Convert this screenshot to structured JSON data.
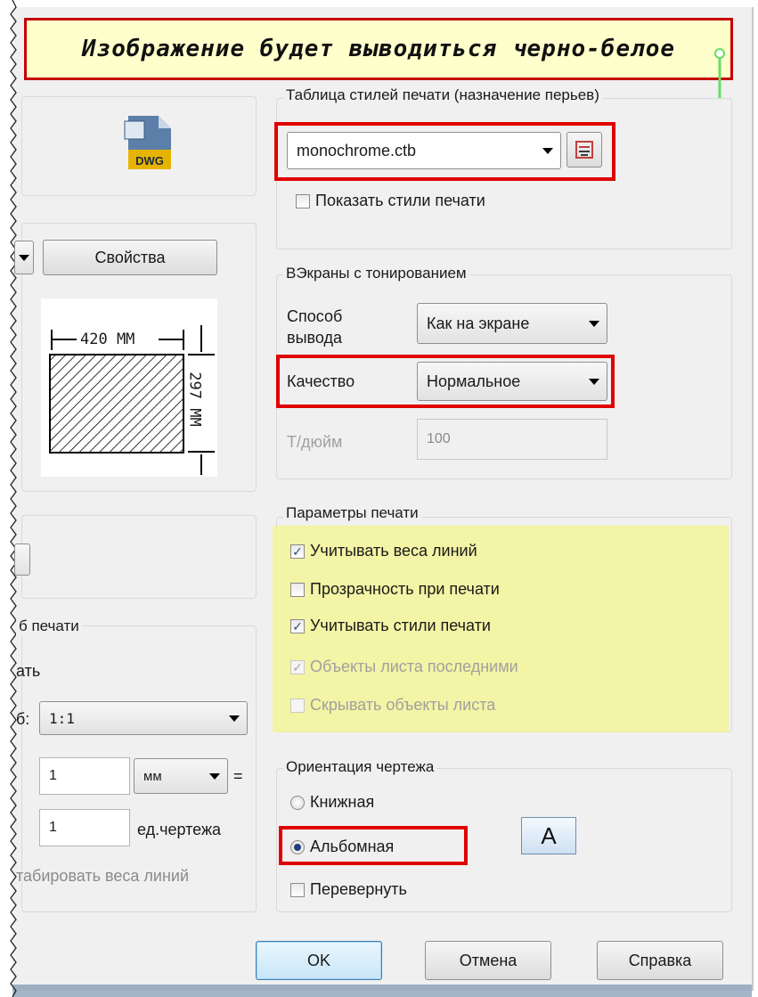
{
  "banner": {
    "text": "Изображение будет выводиться черно-белое"
  },
  "left_panel": {
    "properties_button": "Свойства",
    "paper_width": "420 MM",
    "paper_height": "297 MM",
    "scale_group_title": "б печати",
    "fit_label": "ать",
    "scale_label": "б:",
    "scale_value": "1:1",
    "units_value_1": "1",
    "units_unit": "мм",
    "equals": "=",
    "units_value_2": "1",
    "drawing_units": "ед.чертежа",
    "scale_lineweights": "табировать веса линий"
  },
  "plot_style_table": {
    "title": "Таблица стилей печати (назначение перьев)",
    "selected": "monochrome.ctb",
    "show_styles": "Показать стили печати",
    "show_styles_checked": false
  },
  "shaded_viewport": {
    "title": "ВЭкраны с тонированием",
    "shade_plot_label": "Способ вывода",
    "shade_plot_value": "Как на экране",
    "quality_label": "Качество",
    "quality_value": "Нормальное",
    "dpi_label": "Т/дюйм",
    "dpi_value": "100"
  },
  "plot_options": {
    "title": "Параметры печати",
    "items": [
      {
        "label": "Учитывать веса линий",
        "checked": true,
        "enabled": true
      },
      {
        "label": "Прозрачность при печати",
        "checked": false,
        "enabled": true
      },
      {
        "label": "Учитывать стили печати",
        "checked": true,
        "enabled": true
      },
      {
        "label": "Объекты листа последними",
        "checked": true,
        "enabled": false
      },
      {
        "label": "Скрывать объекты листа",
        "checked": false,
        "enabled": false
      }
    ],
    "highlight_color": "#f4f58c"
  },
  "orientation": {
    "title": "Ориентация чертежа",
    "portrait": "Книжная",
    "landscape": "Альбомная",
    "upside_down": "Перевернуть",
    "selected": "landscape",
    "orientation_icon_letter": "A"
  },
  "buttons": {
    "ok": "OK",
    "cancel": "Отмена",
    "help": "Справка"
  },
  "accent": {
    "highlight_red": "#e00000",
    "arrow_green": "#66dd66"
  }
}
